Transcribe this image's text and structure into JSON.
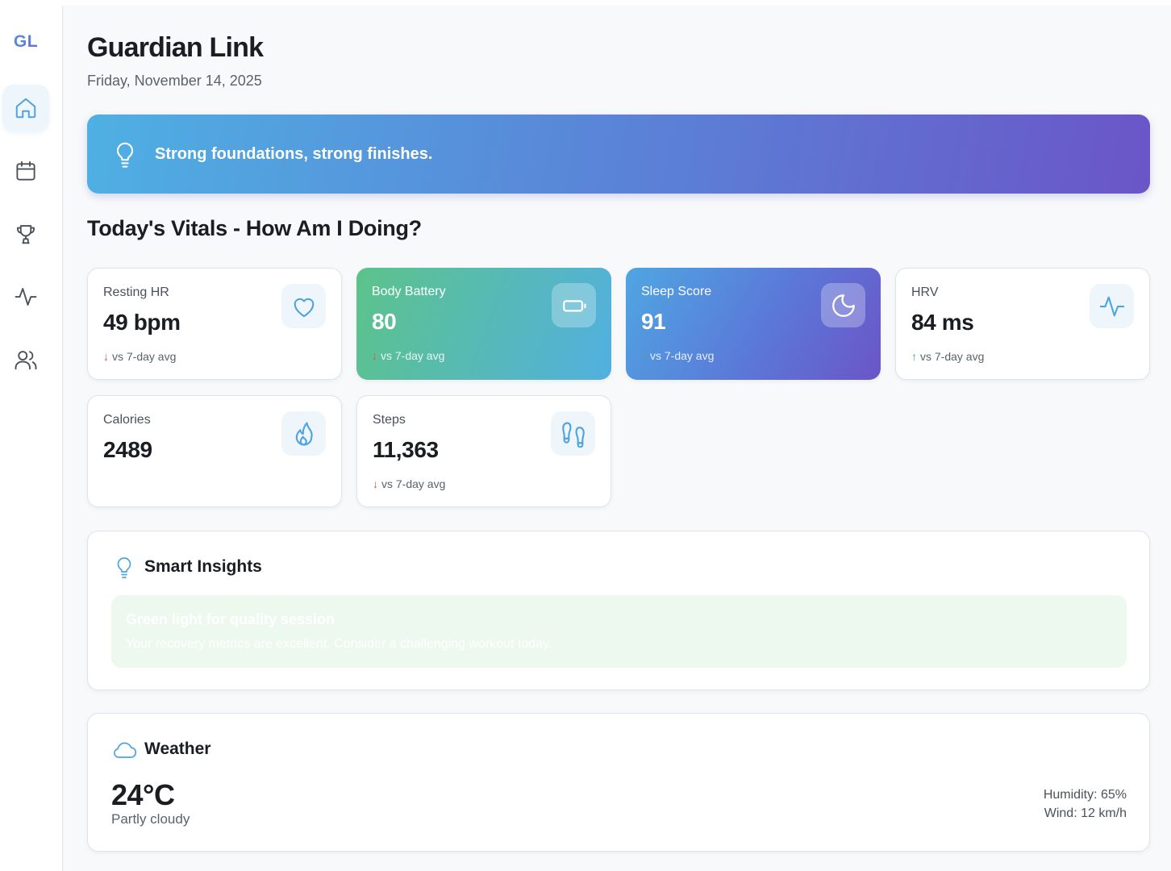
{
  "app": {
    "logo": "GL",
    "title": "Guardian Link",
    "date": "Friday, November 14, 2025"
  },
  "sidebar": {
    "items": [
      {
        "name": "home",
        "icon": "home-icon",
        "active": true
      },
      {
        "name": "calendar",
        "icon": "calendar-icon",
        "active": false
      },
      {
        "name": "achievements",
        "icon": "trophy-icon",
        "active": false
      },
      {
        "name": "activity",
        "icon": "activity-icon",
        "active": false
      },
      {
        "name": "people",
        "icon": "users-icon",
        "active": false
      }
    ]
  },
  "banner": {
    "icon": "lightbulb-icon",
    "text": "Strong foundations, strong finishes."
  },
  "vitals": {
    "title": "Today's Vitals - How Am I Doing?",
    "cards": [
      {
        "label": "Resting HR",
        "value": "49 bpm",
        "trend": "vs 7-day avg",
        "direction": "down",
        "icon": "heart-icon"
      },
      {
        "label": "Body Battery",
        "value": "80",
        "trend": "vs 7-day avg",
        "direction": "down",
        "icon": "battery-icon"
      },
      {
        "label": "Sleep Score",
        "value": "91",
        "trend": "vs 7-day avg",
        "direction": "up",
        "icon": "moon-icon"
      },
      {
        "label": "HRV",
        "value": "84 ms",
        "trend": "vs 7-day avg",
        "direction": "up",
        "icon": "activity-icon"
      },
      {
        "label": "Calories",
        "value": "2489",
        "icon": "flame-icon"
      },
      {
        "label": "Steps",
        "value": "11,363",
        "trend": "vs 7-day avg",
        "direction": "down",
        "icon": "footprints-icon"
      }
    ]
  },
  "insights": {
    "title": "Smart Insights",
    "icon": "lightbulb-icon",
    "item": {
      "title": "Green light for quality session",
      "body": "Your recovery metrics are excellent. Consider a challenging workout today."
    }
  },
  "weather": {
    "title": "Weather",
    "icon": "cloud-icon",
    "temperature": "24°C",
    "condition": "Partly cloudy",
    "humidity": "Humidity: 65%",
    "wind": "Wind: 12 km/h"
  },
  "colors": {
    "accent": "#4fa3e0",
    "purple": "#6b55c8",
    "green": "#5cc38a",
    "down": "#e05050",
    "up": "#3bb56c"
  }
}
